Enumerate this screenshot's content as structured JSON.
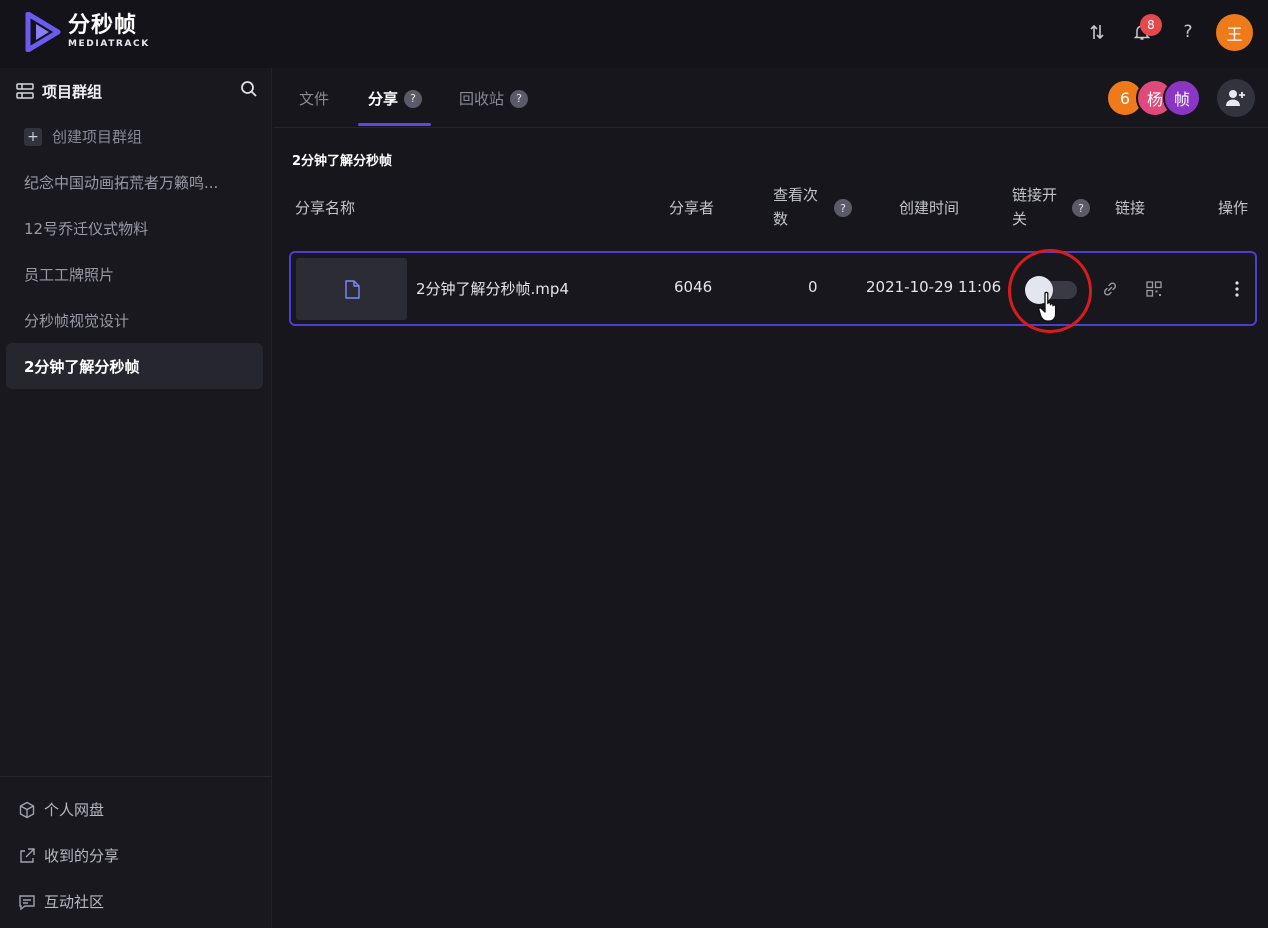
{
  "app": {
    "name": "分秒帧",
    "name_en": "MEDIATRACK"
  },
  "header": {
    "notification_count": "8",
    "help_label": "?",
    "user_initial": "王"
  },
  "sidebar": {
    "title": "项目群组",
    "create_label": "创建项目群组",
    "groups": [
      {
        "label": "纪念中国动画拓荒者万籁鸣..."
      },
      {
        "label": "12号乔迁仪式物料"
      },
      {
        "label": "员工工牌照片"
      },
      {
        "label": "分秒帧视觉设计"
      },
      {
        "label": "2分钟了解分秒帧"
      }
    ],
    "bottom": [
      {
        "label": "个人网盘"
      },
      {
        "label": "收到的分享"
      },
      {
        "label": "互动社区"
      }
    ]
  },
  "tabs": [
    {
      "label": "文件"
    },
    {
      "label": "分享"
    },
    {
      "label": "回收站"
    }
  ],
  "members": {
    "count": "6",
    "avatars": [
      "杨",
      "帧"
    ]
  },
  "content": {
    "group_title": "2分钟了解分秒帧",
    "columns": {
      "name": "分享名称",
      "sharer": "分享者",
      "views_line1": "查看次",
      "views_line2": "数",
      "created": "创建时间",
      "switch_line1": "链接开",
      "switch_line2": "关",
      "link": "链接",
      "actions": "操作"
    },
    "rows": [
      {
        "name": "2分钟了解分秒帧.mp4",
        "sharer": "6046",
        "views": "0",
        "created": "2021-10-29 11:06",
        "link_enabled": false
      }
    ]
  },
  "colors": {
    "accent": "#5b4bd6",
    "avatar_orange": "#ee7a1a",
    "avatar_pink": "#e04a7a",
    "avatar_purple": "#8a35c4",
    "badge_red": "#e5484d",
    "highlight_ring": "#d81c1c"
  }
}
